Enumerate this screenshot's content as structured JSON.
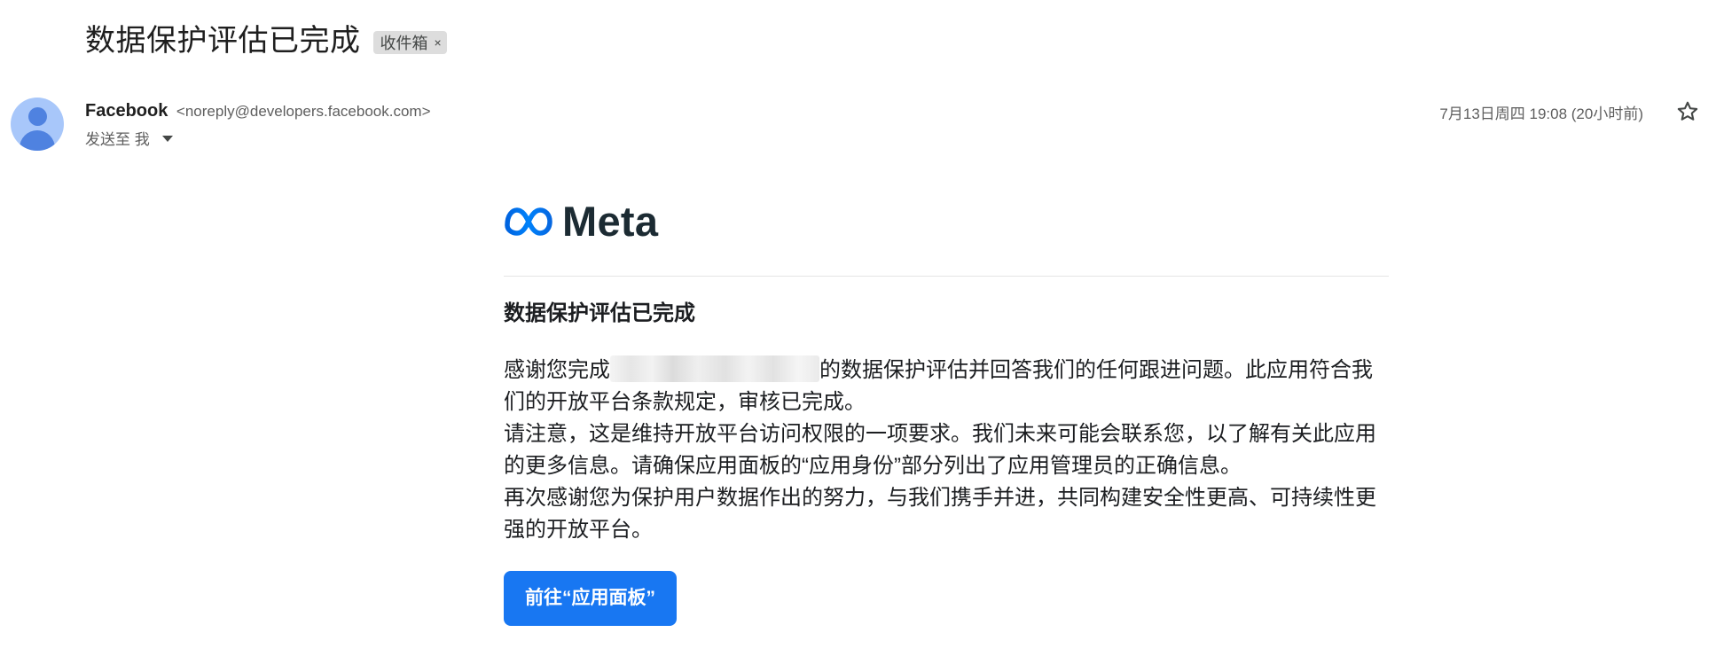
{
  "header": {
    "subject": "数据保护评估已完成",
    "label_chip": "收件箱",
    "label_close": "×"
  },
  "sender": {
    "name": "Facebook",
    "email": "<noreply@developers.facebook.com>",
    "to_label": "发送至 我",
    "timestamp": "7月13日周四 19:08 (20小时前)"
  },
  "email": {
    "logo_text": "Meta",
    "title": "数据保护评估已完成",
    "paragraph1_before": "感谢您完成",
    "paragraph1_after": "的数据保护评估并回答我们的任何跟进问题。此应用符合我们的开放平台条款规定，审核已完成。",
    "paragraph2": "请注意，这是维持开放平台访问权限的一项要求。我们未来可能会联系您，以了解有关此应用的更多信息。请确保应用面板的“应用身份”部分列出了应用管理员的正确信息。",
    "paragraph3": "再次感谢您为保护用户数据作出的努力，与我们携手并进，共同构建安全性更高、可持续性更强的开放平台。",
    "cta_label": "前往“应用面板”"
  },
  "colors": {
    "cta_background": "#1877f2",
    "avatar_background": "#a8c7fa",
    "avatar_figure": "#4f82e0",
    "meta_logo_blue": "#0668e1"
  },
  "icons": {
    "avatar": "person-avatar-icon",
    "star": "star-outline-icon",
    "caret": "caret-down-icon",
    "chip_close": "close-icon",
    "logo": "meta-infinity-logo"
  }
}
